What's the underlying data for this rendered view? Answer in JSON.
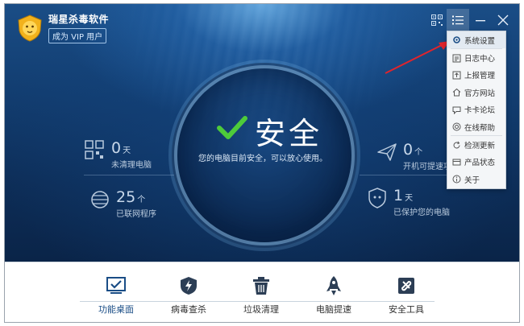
{
  "app": {
    "name": "瑞星杀毒软件",
    "vip_label": "成为 VIP 用户"
  },
  "titlebar": {
    "icons": [
      "qr-code-icon",
      "menu-list-icon",
      "minimize-icon",
      "close-icon"
    ]
  },
  "status": {
    "title": "安全",
    "subtitle": "您的电脑目前安全，可以放心使用。"
  },
  "stats": {
    "uncleaned": {
      "value": "0",
      "unit": "天",
      "label": "未清理电脑"
    },
    "networked": {
      "value": "25",
      "unit": "个",
      "label": "已联网程序"
    },
    "startup": {
      "value": "0",
      "unit": "个",
      "label": "开机可提速项"
    },
    "protected": {
      "value": "1",
      "unit": "天",
      "label": "已保护您的电脑"
    }
  },
  "menu": {
    "items": [
      {
        "label": "系统设置",
        "icon": "gear-icon"
      },
      {
        "label": "日志中心",
        "icon": "log-icon"
      },
      {
        "label": "上报管理",
        "icon": "report-icon"
      },
      {
        "label": "官方网站",
        "icon": "home-icon"
      },
      {
        "label": "卡卡论坛",
        "icon": "forum-icon"
      },
      {
        "label": "在线帮助",
        "icon": "help-icon"
      },
      {
        "label": "检测更新",
        "icon": "refresh-icon"
      },
      {
        "label": "产品状态",
        "icon": "product-status-icon"
      },
      {
        "label": "关于",
        "icon": "info-icon"
      }
    ]
  },
  "nav": {
    "items": [
      {
        "label": "功能桌面",
        "icon": "desktop-check-icon"
      },
      {
        "label": "病毒查杀",
        "icon": "shield-lightning-icon"
      },
      {
        "label": "垃圾清理",
        "icon": "trash-icon"
      },
      {
        "label": "电脑提速",
        "icon": "rocket-icon"
      },
      {
        "label": "安全工具",
        "icon": "toolbox-icon"
      }
    ]
  },
  "colors": {
    "accent": "#1a4d86",
    "check": "#4ecb3a",
    "arrow": "#e0242c"
  }
}
